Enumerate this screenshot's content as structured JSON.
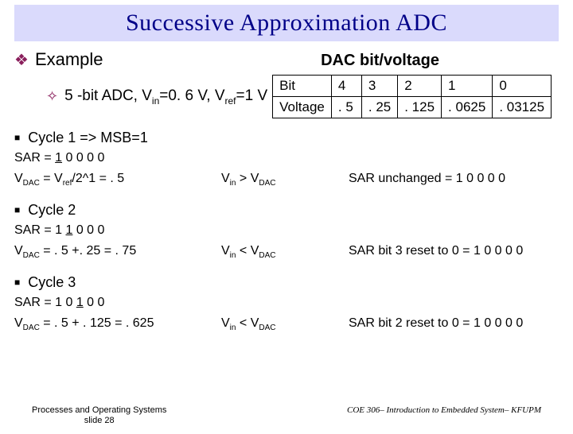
{
  "title": "Successive Approximation ADC",
  "example_label": "Example",
  "dac_caption": "DAC bit/voltage",
  "sub_bullet": "5 -bit ADC, Vin=0. 6 V, Vref=1 V",
  "dac_table": {
    "r1": {
      "h": "Bit",
      "c0": "4",
      "c1": "3",
      "c2": "2",
      "c3": "1",
      "c4": "0"
    },
    "r2": {
      "h": "Voltage",
      "c0": ". 5",
      "c1": ". 25",
      "c2": ". 125",
      "c3": ". 0625",
      "c4": ". 03125"
    }
  },
  "c1": {
    "title": "Cycle 1 => MSB=1",
    "sar_pre": "SAR = ",
    "sar_u": "1",
    "sar_post": " 0 0 0 0",
    "vdac": "VDAC = Vref/2^1 = . 5",
    "cmp": "Vin > VDAC",
    "res": "SAR unchanged = 1 0 0 0 0"
  },
  "c2": {
    "title": "Cycle 2",
    "sar_pre": "SAR = 1 ",
    "sar_u": "1",
    "sar_post": " 0 0 0",
    "vdac": "VDAC = . 5 +. 25 = . 75",
    "cmp": "Vin < VDAC",
    "res": "SAR bit 3 reset to 0 = 1 0 0 0 0"
  },
  "c3": {
    "title": "Cycle 3",
    "sar_pre": "SAR = 1 0 ",
    "sar_u": "1",
    "sar_post": " 0 0",
    "vdac": "VDAC = . 5 + . 125 = . 625",
    "cmp": "Vin < VDAC",
    "res": "SAR bit 2 reset to 0 = 1 0 0 0 0"
  },
  "footer_left_l1": "Processes and Operating Systems",
  "footer_left_l2": "slide 28",
  "footer_right": "COE 306– Introduction to Embedded System– KFUPM"
}
